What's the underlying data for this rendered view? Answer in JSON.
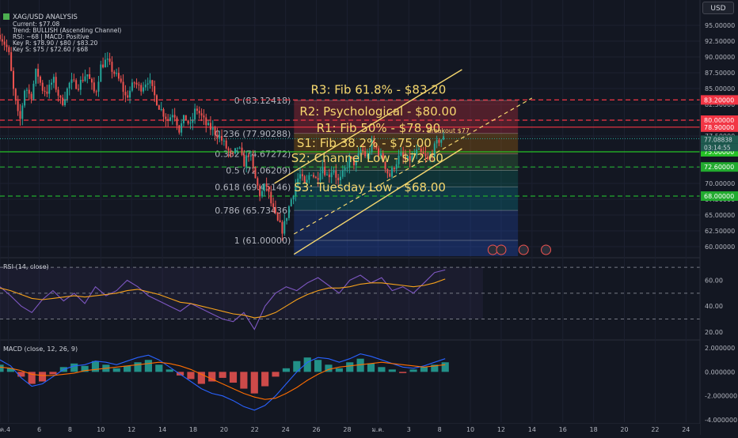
{
  "header": {
    "title": "XAG/USD ANALYSIS",
    "lines": [
      "Current: $77.08",
      "Trend: BULLISH (Ascending Channel)",
      "RSI: ~68 | MACD: Positive",
      "Key R: $78.90 / $80 / $83.20",
      "Key S: $75 / $72.60 / $68"
    ]
  },
  "toolbar": {
    "currency_label": "USD"
  },
  "colors": {
    "background": "#131722",
    "grid": "#1c2030",
    "bull": "#26a69a",
    "bear": "#ef5350",
    "resistance": "#f23645",
    "support": "#22ab2f",
    "key_level": "#26c126",
    "channel": "#f5d76e",
    "rsi_line": "#7e57c2",
    "rsi_ma": "#f7a21b",
    "macd_line": "#2962ff",
    "signal_line": "#ff6d00"
  },
  "chart_data": [
    {
      "type": "candlestick",
      "pane": "price",
      "ylim": [
        58.5,
        98.5
      ],
      "y_ticks": [
        60,
        62.5,
        65,
        67.5,
        70,
        72.5,
        75,
        77.5,
        80,
        82.5,
        85,
        87.5,
        90,
        92.5,
        95
      ],
      "x_labels": [
        {
          "label": "ก.ค.",
          "bar": 0
        },
        {
          "label": "4",
          "bar": 6
        },
        {
          "label": "6",
          "bar": 28
        },
        {
          "label": "8",
          "bar": 50
        },
        {
          "label": "10",
          "bar": 72
        },
        {
          "label": "12",
          "bar": 94
        },
        {
          "label": "14",
          "bar": 116
        },
        {
          "label": "18",
          "bar": 138
        },
        {
          "label": "20",
          "bar": 160
        },
        {
          "label": "22",
          "bar": 182
        },
        {
          "label": "24",
          "bar": 204
        },
        {
          "label": "26",
          "bar": 226
        },
        {
          "label": "28",
          "bar": 248
        },
        {
          "label": "ม.ค.",
          "bar": 270
        },
        {
          "label": "3",
          "bar": 292
        },
        {
          "label": "8",
          "bar": 314
        },
        {
          "label": "10",
          "bar": 336
        },
        {
          "label": "12",
          "bar": 358
        },
        {
          "label": "14",
          "bar": 380
        },
        {
          "label": "16",
          "bar": 402
        },
        {
          "label": "18",
          "bar": 424
        },
        {
          "label": "20",
          "bar": 446
        },
        {
          "label": "22",
          "bar": 468
        },
        {
          "label": "24",
          "bar": 490
        }
      ],
      "bar_count_visible": 500,
      "price_path": [
        [
          0,
          93.5
        ],
        [
          6,
          91.0
        ],
        [
          10,
          84.0
        ],
        [
          14,
          79.5
        ],
        [
          18,
          85.5
        ],
        [
          22,
          83.5
        ],
        [
          26,
          88.0
        ],
        [
          30,
          85.0
        ],
        [
          34,
          84.5
        ],
        [
          38,
          86.5
        ],
        [
          44,
          82.5
        ],
        [
          50,
          86.0
        ],
        [
          56,
          85.5
        ],
        [
          62,
          87.5
        ],
        [
          68,
          84.0
        ],
        [
          72,
          88.5
        ],
        [
          76,
          89.5
        ],
        [
          80,
          88.0
        ],
        [
          86,
          86.0
        ],
        [
          90,
          83.5
        ],
        [
          96,
          86.0
        ],
        [
          100,
          85.0
        ],
        [
          106,
          86.5
        ],
        [
          110,
          84.0
        ],
        [
          114,
          82.0
        ],
        [
          120,
          80.0
        ],
        [
          124,
          81.5
        ],
        [
          128,
          78.5
        ],
        [
          132,
          80.5
        ],
        [
          136,
          79.0
        ],
        [
          140,
          82.0
        ],
        [
          144,
          80.5
        ],
        [
          148,
          79.0
        ],
        [
          152,
          78.5
        ],
        [
          158,
          77.0
        ],
        [
          162,
          75.5
        ],
        [
          166,
          74.0
        ],
        [
          170,
          76.0
        ],
        [
          174,
          73.0
        ],
        [
          178,
          75.0
        ],
        [
          182,
          71.0
        ],
        [
          186,
          68.0
        ],
        [
          190,
          70.0
        ],
        [
          194,
          66.5
        ],
        [
          198,
          64.0
        ],
        [
          202,
          62.5
        ],
        [
          206,
          66.0
        ],
        [
          210,
          69.0
        ],
        [
          214,
          71.5
        ],
        [
          218,
          69.5
        ],
        [
          222,
          72.0
        ],
        [
          226,
          70.5
        ],
        [
          230,
          73.0
        ],
        [
          234,
          71.0
        ],
        [
          238,
          72.5
        ],
        [
          242,
          70.0
        ],
        [
          246,
          72.0
        ],
        [
          250,
          74.0
        ],
        [
          254,
          73.0
        ],
        [
          258,
          75.5
        ],
        [
          262,
          74.0
        ],
        [
          266,
          76.5
        ],
        [
          270,
          75.0
        ],
        [
          274,
          73.5
        ],
        [
          278,
          71.0
        ],
        [
          282,
          73.0
        ],
        [
          286,
          74.5
        ],
        [
          290,
          73.5
        ],
        [
          294,
          74.0
        ],
        [
          298,
          75.0
        ],
        [
          302,
          74.5
        ],
        [
          306,
          73.5
        ],
        [
          310,
          75.5
        ],
        [
          314,
          77.0
        ],
        [
          318,
          77.08
        ]
      ],
      "current_price": 77.08,
      "annotations": [
        {
          "label": "R3: Fib 61.8% - $83.20",
          "price": 83.2
        },
        {
          "label": "R2: Psychological - $80.00",
          "price": 80.0
        },
        {
          "label": "R1: Fib 50% - $78.90",
          "price": 78.9
        },
        {
          "label": "S1: Fib 38.2% - $75.00",
          "price": 75.0
        },
        {
          "label": "S2: Channel Low - $72.60",
          "price": 72.6
        },
        {
          "label": "S3: Tuesday Low - $68.00",
          "price": 68.0
        },
        {
          "label": "Breakout $77",
          "price": 77.0
        }
      ],
      "fib_levels": [
        {
          "label": "0 (83.12418)",
          "price": 83.12418
        },
        {
          "label": "0.236 (77.90288)",
          "price": 77.90288
        },
        {
          "label": "0.382 (74.67272)",
          "price": 74.67272
        },
        {
          "label": "0.5 (72.06209)",
          "price": 72.06209
        },
        {
          "label": "0.618 (69.45146)",
          "price": 69.45146
        },
        {
          "label": "0.786 (65.73436)",
          "price": 65.73436
        },
        {
          "label": "1 (61.00000)",
          "price": 61.0
        }
      ],
      "horizontal_lines": [
        {
          "price": 83.2,
          "style": "dashed",
          "color": "#f23645",
          "tag": "83.20000"
        },
        {
          "price": 80.0,
          "style": "dashed",
          "color": "#f23645",
          "tag": "80.00000"
        },
        {
          "price": 78.9,
          "style": "solid",
          "color": "#f23645",
          "tag": "78.90000"
        },
        {
          "price": 75.0,
          "style": "solid",
          "color": "#26c126",
          "tag": "75.00000"
        },
        {
          "price": 72.6,
          "style": "dashed",
          "color": "#22ab2f",
          "tag": "72.60000"
        },
        {
          "price": 68.0,
          "style": "dashed",
          "color": "#22ab2f",
          "tag": "68.00000"
        }
      ],
      "price_tags": [
        {
          "value": "77.08838",
          "color": "#26a69a"
        },
        {
          "value": "03:14:55",
          "color": "#26a69a"
        }
      ]
    },
    {
      "type": "line",
      "pane": "rsi",
      "title": "RSI (14, close)",
      "ylim": [
        15,
        75
      ],
      "y_ticks": [
        20,
        40,
        60
      ],
      "levels": [
        70,
        50,
        30
      ],
      "series": [
        {
          "name": "RSI",
          "values": [
            55,
            48,
            40,
            35,
            45,
            52,
            44,
            50,
            42,
            55,
            48,
            52,
            60,
            55,
            48,
            44,
            40,
            36,
            42,
            38,
            34,
            30,
            28,
            35,
            22,
            40,
            50,
            55,
            52,
            58,
            62,
            56,
            50,
            60,
            64,
            58,
            62,
            52,
            55,
            50,
            58,
            66,
            68
          ]
        },
        {
          "name": "RSI-based MA",
          "values": [
            54,
            52,
            49,
            46,
            45,
            46,
            47,
            48,
            47,
            48,
            49,
            50,
            52,
            53,
            51,
            49,
            46,
            43,
            42,
            40,
            38,
            36,
            34,
            33,
            31,
            32,
            35,
            40,
            45,
            49,
            52,
            54,
            54,
            55,
            57,
            58,
            58,
            57,
            56,
            55,
            56,
            58,
            61
          ]
        }
      ]
    },
    {
      "type": "bar",
      "pane": "macd",
      "title": "MACD (close, 12, 26, 9)",
      "ylim": [
        -4.2,
        2.4
      ],
      "y_ticks": [
        2,
        0,
        -2,
        -4
      ],
      "histogram": [
        0.6,
        0.3,
        -0.4,
        -1.0,
        -0.8,
        -0.2,
        0.4,
        0.7,
        0.5,
        0.9,
        0.6,
        0.3,
        0.5,
        0.8,
        1.0,
        0.6,
        0.2,
        -0.3,
        -0.6,
        -1.0,
        -0.8,
        -0.5,
        -0.9,
        -1.4,
        -1.8,
        -1.2,
        -0.4,
        0.3,
        0.9,
        1.2,
        1.0,
        0.6,
        0.3,
        0.8,
        1.1,
        0.7,
        0.4,
        0.2,
        -0.1,
        0.2,
        0.4,
        0.6,
        0.8
      ],
      "series": [
        {
          "name": "MACD",
          "values": [
            1.0,
            0.5,
            -0.5,
            -1.2,
            -1.0,
            -0.4,
            0.2,
            0.5,
            0.6,
            0.9,
            0.8,
            0.6,
            0.9,
            1.2,
            1.4,
            1.0,
            0.4,
            -0.2,
            -0.8,
            -1.4,
            -1.8,
            -2.0,
            -2.4,
            -2.9,
            -3.2,
            -2.8,
            -2.0,
            -1.0,
            0.0,
            0.8,
            1.2,
            1.1,
            0.8,
            1.1,
            1.5,
            1.3,
            1.0,
            0.7,
            0.4,
            0.3,
            0.5,
            0.8,
            1.1
          ]
        },
        {
          "name": "Signal",
          "values": [
            0.4,
            0.3,
            0.1,
            -0.2,
            -0.3,
            -0.3,
            -0.2,
            -0.1,
            0.1,
            0.2,
            0.3,
            0.4,
            0.5,
            0.6,
            0.7,
            0.8,
            0.7,
            0.5,
            0.2,
            -0.2,
            -0.6,
            -1.0,
            -1.4,
            -1.8,
            -2.1,
            -2.3,
            -2.2,
            -1.8,
            -1.3,
            -0.7,
            -0.2,
            0.2,
            0.4,
            0.5,
            0.6,
            0.7,
            0.8,
            0.7,
            0.6,
            0.5,
            0.4,
            0.5,
            0.6
          ]
        }
      ]
    }
  ]
}
